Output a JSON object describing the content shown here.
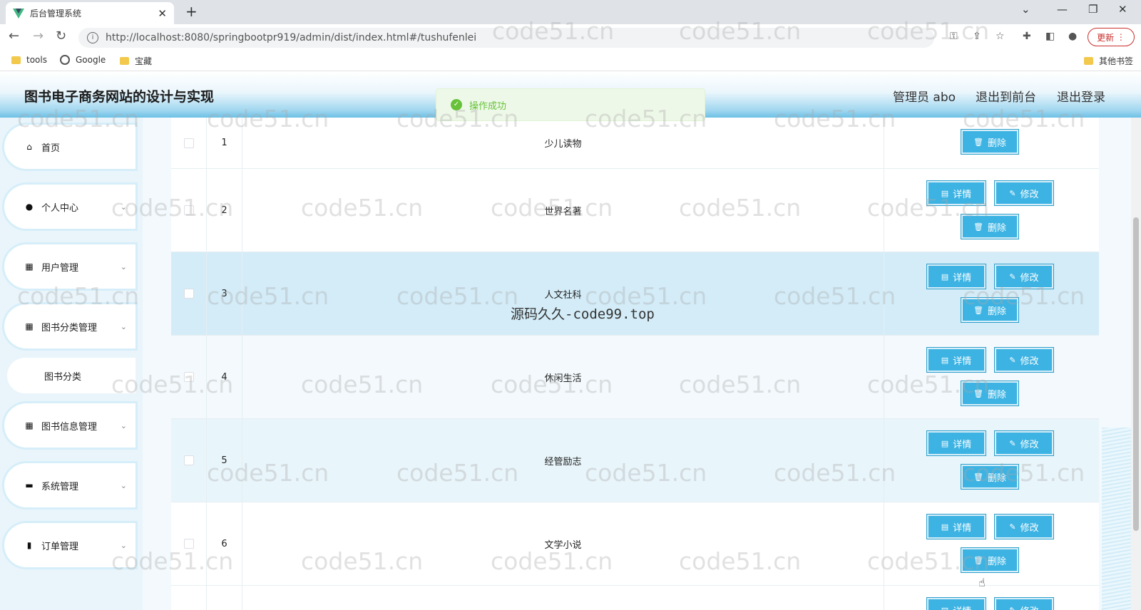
{
  "browser": {
    "tab_title": "后台管理系统",
    "url": "http://localhost:8080/springbootpr919/admin/dist/index.html#/tushufenlei",
    "update_label": "更新",
    "bookmarks": [
      "tools",
      "Google",
      "宝藏"
    ],
    "other_bookmarks": "其他书签"
  },
  "header": {
    "title": "图书电子商务网站的设计与实现",
    "admin_label": "管理员 abo",
    "front_label": "退出到前台",
    "logout_label": "退出登录"
  },
  "toast": {
    "message": "操作成功"
  },
  "sidebar": {
    "items": [
      {
        "label": "首页",
        "icon": "home-icon"
      },
      {
        "label": "个人中心",
        "icon": "user-icon"
      },
      {
        "label": "用户管理",
        "icon": "grid-icon"
      },
      {
        "label": "图书分类管理",
        "icon": "grid-icon"
      },
      {
        "label": "图书信息管理",
        "icon": "grid-icon"
      },
      {
        "label": "系统管理",
        "icon": "briefcase-icon"
      },
      {
        "label": "订单管理",
        "icon": "bar-chart-icon"
      }
    ],
    "submenu": {
      "label": "图书分类"
    }
  },
  "table": {
    "rows": [
      {
        "index": "1",
        "name": "少儿读物"
      },
      {
        "index": "2",
        "name": "世界名著"
      },
      {
        "index": "3",
        "name": "人文社科"
      },
      {
        "index": "4",
        "name": "休闲生活"
      },
      {
        "index": "5",
        "name": "经管励志"
      },
      {
        "index": "6",
        "name": "文学小说"
      }
    ],
    "actions": {
      "detail": "详情",
      "edit": "修改",
      "delete": "删除"
    }
  },
  "watermarks": {
    "repeat": "code51.cn",
    "center": "源码久久-code99.top"
  },
  "colors": {
    "accent": "#3cb3e3",
    "highlight_row": "#d3ecf7",
    "success": "#67c23a"
  }
}
